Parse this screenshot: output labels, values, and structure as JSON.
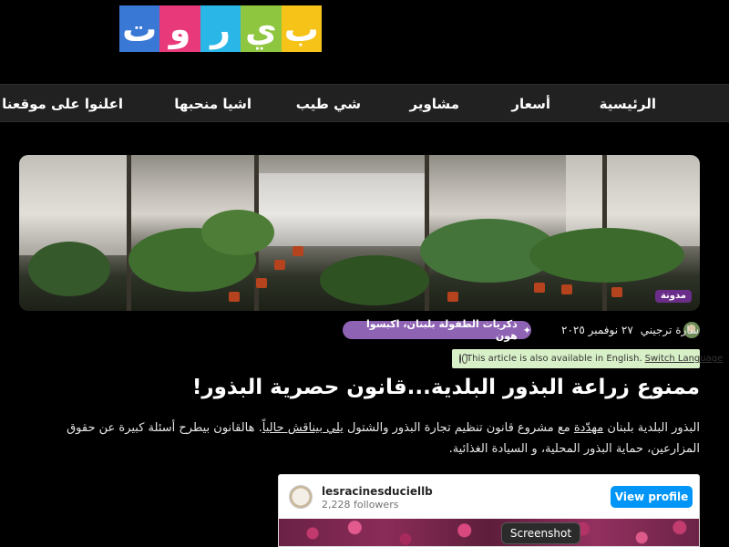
{
  "logo": {
    "letters": [
      "ب",
      "ي",
      "ر",
      "و",
      "ت"
    ],
    "colors": [
      "#3a78d6",
      "#e8397a",
      "#2ab7e8",
      "#8ec63f",
      "#f6c319"
    ]
  },
  "nav": {
    "items": [
      "الرئيسية",
      "أسعار",
      "مشاوير",
      "شي طيب",
      "اشيا منحبها",
      "اعلنوا على موقعنا"
    ]
  },
  "article": {
    "category_badge": "مدونة",
    "author": "سارة ترجيني",
    "date": "٢٧ نوفمبر ٢٠٢٥",
    "series_pill": "ذكريات الطفولة بلبنان، اكبسوا هون",
    "language_notice": "This article is also available in English.",
    "switch_language": "Switch Language",
    "headline": "ممنوع زراعة البذور البلدية...قانون حصرية البذور!",
    "body": {
      "part1": "البذور البلدية بلبنان ",
      "link1": "مهدّدة",
      "part2": " مع مشروع قانون تنظيم تجارة البذور والشتول ",
      "link2": "يلي بيناقش حالياً",
      "part3": ". هالقانون بيطرح أسئلة كبيرة عن حقوق المزارعين، حماية البذور المحلية، و السيادة الغذائية."
    }
  },
  "embed": {
    "username": "lesracinesduciellb",
    "followers": "2,228 followers",
    "view_profile": "View profile"
  },
  "tooltip": "Screenshot",
  "colors": {
    "nav_bg": "#212121",
    "pill": "#8e63b3",
    "badge": "#6a2e8a",
    "lang_banner": "#d8f0c7",
    "instagram_blue": "#0095f6"
  }
}
